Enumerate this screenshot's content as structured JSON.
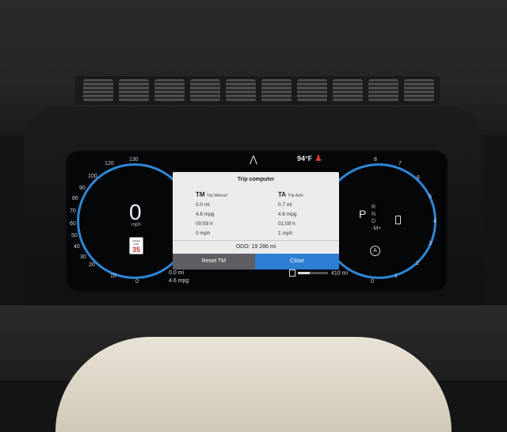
{
  "status": {
    "temperature": "94°F",
    "road_icon": "road-icon",
    "seatbelt_icon": "seatbelt-warning-icon"
  },
  "speedometer": {
    "speed": "0",
    "unit": "mph",
    "ticks": [
      "130",
      "120",
      "100",
      "90",
      "80",
      "70",
      "60",
      "50",
      "40",
      "30",
      "20",
      "10",
      "0"
    ],
    "speed_limit": {
      "label": "SPEED LIMIT",
      "value": "35"
    }
  },
  "tachometer": {
    "ticks": [
      "8",
      "7",
      "6",
      "5",
      "4",
      "3",
      "2",
      "1",
      "0"
    ],
    "gear_selected": "P",
    "gears": [
      "R",
      "N",
      "D",
      "-M+"
    ]
  },
  "trip_computer": {
    "title": "Trip computer",
    "left_header_code": "TM",
    "left_header_label": "Trip Manual",
    "right_header_code": "TA",
    "right_header_label": "Trip Auto",
    "left_values": [
      "0.0 mi",
      "4.6 mpg",
      "00:59 h",
      "0 mph"
    ],
    "right_values": [
      "0.7 mi",
      "4.6 mpg",
      "01:09 h",
      "1 mph"
    ],
    "odometer": "ODO: 19 286 mi",
    "reset_label": "Reset TM",
    "close_label": "Close"
  },
  "bottom": {
    "trip_distance": "0.0 mi",
    "trip_mpg": "4.6 mpg",
    "range": "410 mi"
  },
  "colors": {
    "accent_blue": "#2c7fd3",
    "warning_red": "#d23b2f"
  }
}
